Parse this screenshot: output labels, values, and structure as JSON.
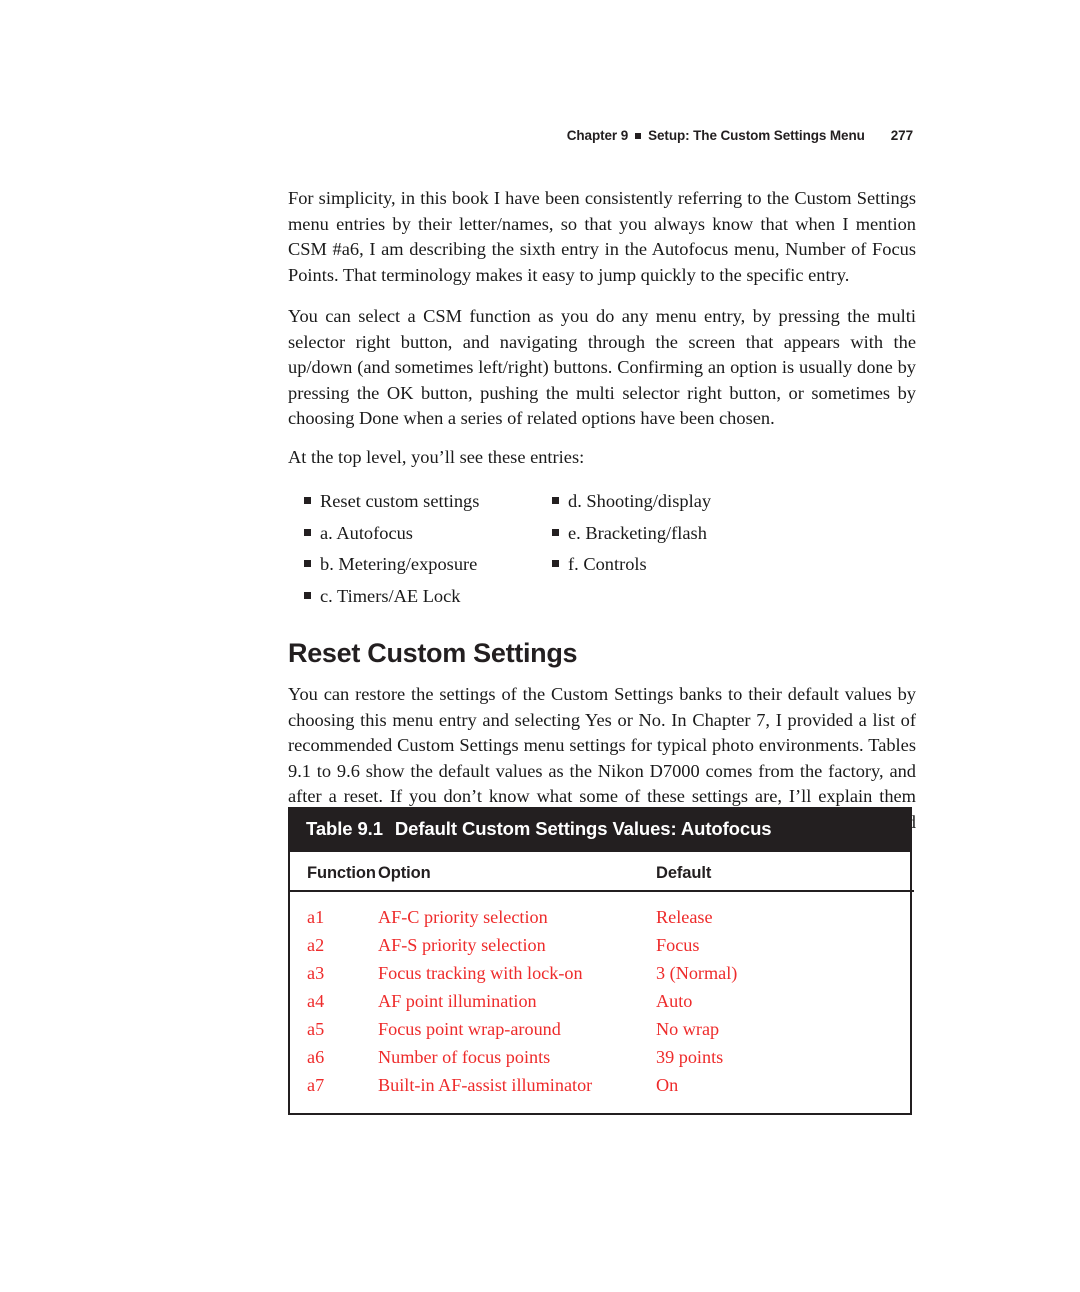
{
  "running_head": {
    "chapter": "Chapter 9",
    "separator_icon": "filled-square",
    "title": "Setup: The Custom Settings Menu",
    "page_number": "277"
  },
  "body": {
    "paragraph_1": "For simplicity, in this book I have been consistently referring to the Custom Settings menu entries by their letter/names, so that you always know that when I mention CSM #a6, I am describing the sixth entry in the Autofocus menu, Number of Focus Points. That terminology makes it easy to jump quickly to the specific entry.",
    "paragraph_2": "You can select a CSM function as you do any menu entry, by pressing the multi selector right button, and navigating through the screen that appears with the up/down (and sometimes left/right) buttons. Confirming an option is usually done by pressing the OK button, pushing the multi selector right button, or sometimes by choosing Done when a series of related options have been chosen.",
    "paragraph_3": "At the top level, you’ll see these entries:"
  },
  "entries_list": {
    "bullet_icon": "filled-square",
    "left_column": [
      "Reset custom settings",
      "a. Autofocus",
      "b. Metering/exposure",
      "c. Timers/AE Lock"
    ],
    "right_column": [
      "d. Shooting/display",
      "e. Bracketing/flash",
      "f. Controls"
    ]
  },
  "section": {
    "heading": "Reset Custom Settings",
    "paragraph": "You can restore the settings of the Custom Settings banks to their default values by choosing this menu entry and selecting Yes or No. In Chapter 7, I provided a list of recommended Custom Settings menu settings for typical photo environments. Tables 9.1 to 9.6 show the default values as the Nikon D7000 comes from the factory, and after a reset. If you don’t know what some of these settings are, I’ll explain them later in this chapter. Be careful when changing any of your carefully tailored customized settings back to the defaults."
  },
  "table": {
    "label": "Table 9.1",
    "caption": "Default Custom Settings Values: Autofocus",
    "banner_color": "#231f20",
    "row_text_color": "#ee2b2b",
    "columns": [
      "Function",
      "Option",
      "Default"
    ],
    "rows": [
      {
        "function": "a1",
        "option": "AF-C priority selection",
        "default": "Release"
      },
      {
        "function": "a2",
        "option": "AF-S priority selection",
        "default": "Focus"
      },
      {
        "function": "a3",
        "option": "Focus tracking with lock-on",
        "default": "3 (Normal)"
      },
      {
        "function": "a4",
        "option": "AF point illumination",
        "default": "Auto"
      },
      {
        "function": "a5",
        "option": "Focus point wrap-around",
        "default": "No wrap"
      },
      {
        "function": "a6",
        "option": "Number of focus points",
        "default": "39 points"
      },
      {
        "function": "a7",
        "option": "Built-in AF-assist illuminator",
        "default": "On"
      }
    ]
  }
}
